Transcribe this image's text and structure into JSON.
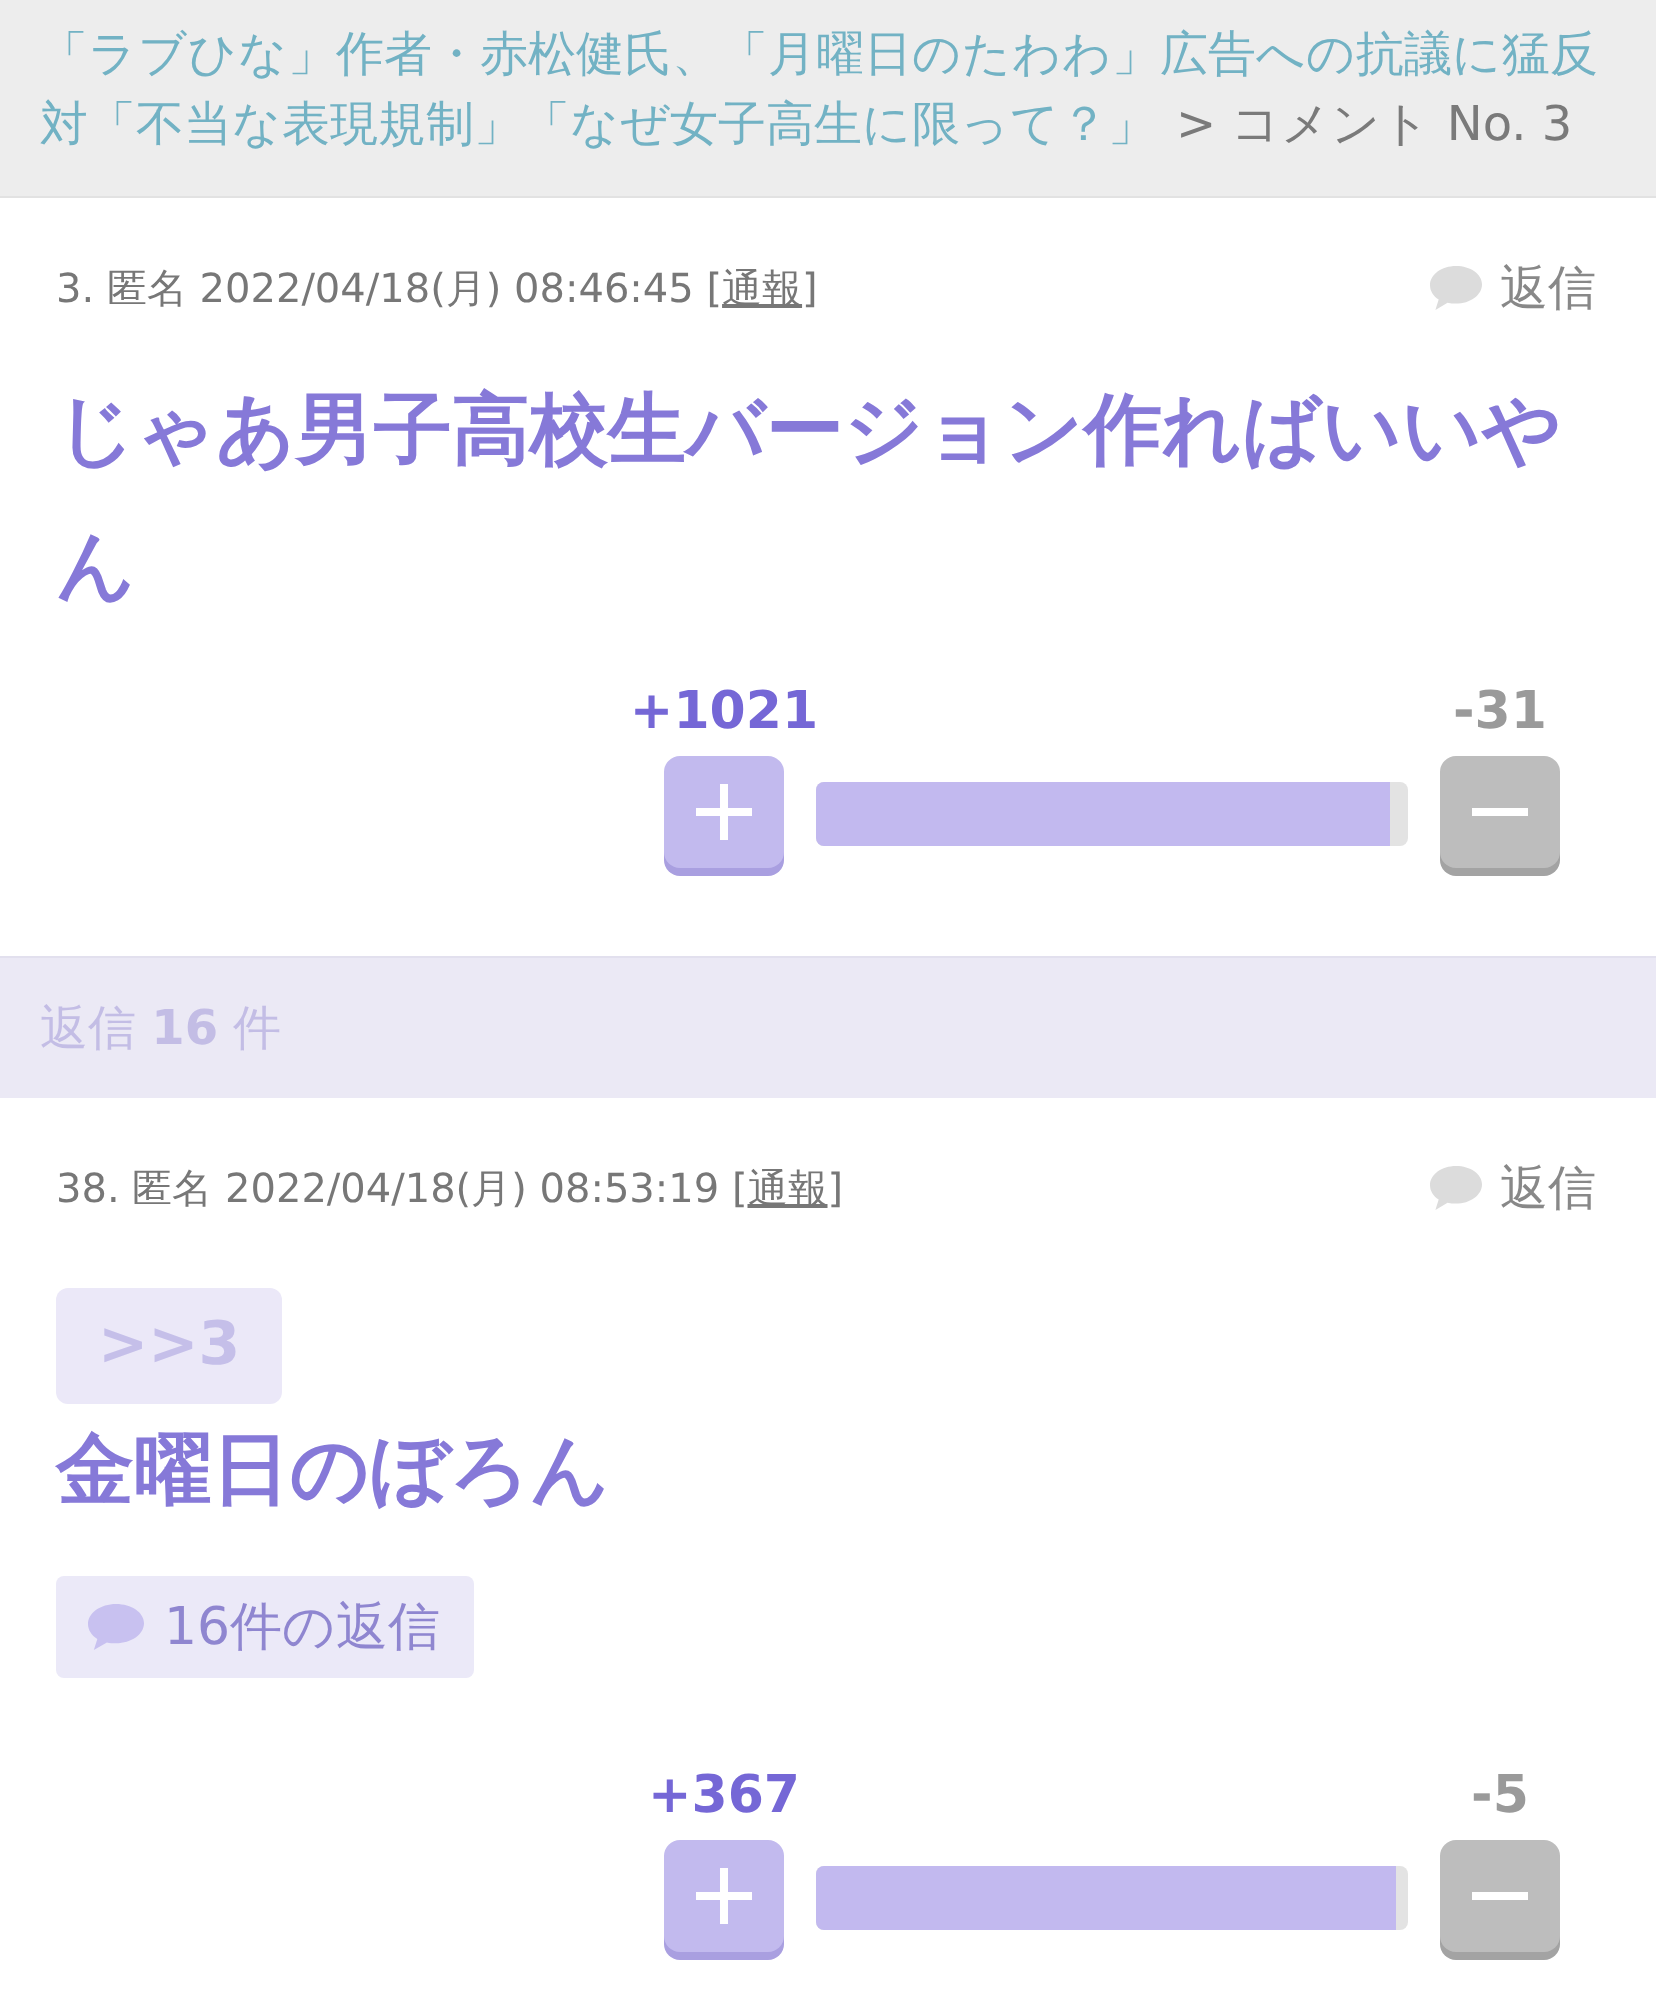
{
  "breadcrumb": {
    "article_link": "「ラブひな」作者・赤松健氏、「月曜日のたわわ」広告への抗議に猛反対「不当な表現規制」「なぜ女子高生に限って？」",
    "current": "> コメント No. 3"
  },
  "comment": {
    "meta_prefix": "3. 匿名 2022/04/18(月) 08:46:45 [",
    "report_link": "通報",
    "meta_suffix": "]",
    "reply_label": "返信",
    "body": "じゃあ男子高校生バージョン作ればいいやん",
    "votes": {
      "plus": "+1021",
      "minus": "-31",
      "level": 0.97
    }
  },
  "replies_header": {
    "text": "返信 **16** 件"
  },
  "replies": [
    {
      "meta_prefix": "38. 匿名 2022/04/18(月) 08:53:19 [",
      "report_link": "通報",
      "meta_suffix": "]",
      "reply_label": "返信",
      "quote": ">>3",
      "body": "金曜日のぼろん",
      "reply_count": "16件の返信",
      "votes": {
        "plus": "+367",
        "minus": "-5",
        "level": 0.98
      }
    }
  ]
}
